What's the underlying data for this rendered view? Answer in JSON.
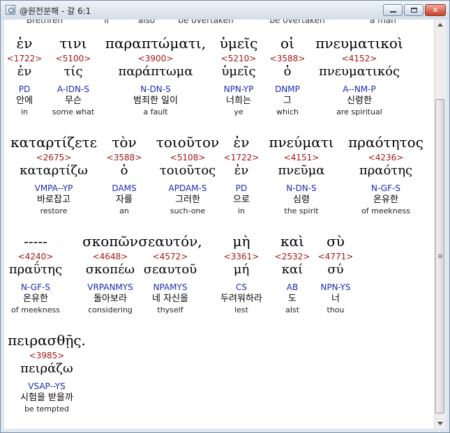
{
  "window": {
    "title": "@원전분해 - 갈 6:1",
    "icon": "app-icon",
    "controls": {
      "minimize": "minimize-icon",
      "maximize": "maximize-icon",
      "close": "close-icon"
    }
  },
  "top_partial": [
    "Brethren",
    "if",
    "also",
    "be overtaken",
    "be overtaken",
    "a man"
  ],
  "rows": [
    {
      "words": [
        {
          "greek": "ἐν",
          "num": "<1722>",
          "lemma": "ἐν",
          "parse": "PD",
          "korean": "안에",
          "english": "in"
        },
        {
          "greek": "τινι",
          "num": "<5100>",
          "lemma": "τίς",
          "parse": "A-IDN-S",
          "korean": "무슨",
          "english": "some what"
        },
        {
          "greek": "παραπτώματι,",
          "num": "<3900>",
          "lemma": "παράπτωμα",
          "parse": "N-DN-S",
          "korean": "범죄한 일이",
          "english": "a fault"
        },
        {
          "greek": "ὑμεῖς",
          "num": "<5210>",
          "lemma": "ὑμεῖς",
          "parse": "NPN-YP",
          "korean": "너희는",
          "english": "ye"
        },
        {
          "greek": "οἱ",
          "num": "<3588>",
          "lemma": "ὁ",
          "parse": "DNMP",
          "korean": "그",
          "english": "which"
        },
        {
          "greek": "πνευματικοὶ",
          "num": "<4152>",
          "lemma": "πνευματικός",
          "parse": "A--NM-P",
          "korean": "신령한",
          "english": "are spiritual"
        }
      ]
    },
    {
      "words": [
        {
          "greek": "καταρτίζετε",
          "num": "<2675>",
          "lemma": "καταρτίζω",
          "parse": "VMPA--YP",
          "korean": "바로잡고",
          "english": "restore"
        },
        {
          "greek": "τὸν",
          "num": "<3588>",
          "lemma": "ὁ",
          "parse": "DAMS",
          "korean": "자를",
          "english": "an"
        },
        {
          "greek": "τοιοῦτον",
          "num": "<5108>",
          "lemma": "τοιοῦτος",
          "parse": "APDAM-S",
          "korean": "그러한",
          "english": "such-one"
        },
        {
          "greek": "ἐν",
          "num": "<1722>",
          "lemma": "ἐν",
          "parse": "PD",
          "korean": "으로",
          "english": "in"
        },
        {
          "greek": "πνεύματι",
          "num": "<4151>",
          "lemma": "πνεῦμα",
          "parse": "N-DN-S",
          "korean": "심령",
          "english": "the spirit"
        },
        {
          "greek": "πραότητος",
          "num": "<4236>",
          "lemma": "πραότης",
          "parse": "N-GF-S",
          "korean": "온유한",
          "english": "of meekness"
        }
      ]
    },
    {
      "words": [
        {
          "greek": "-----",
          "num": "<4240>",
          "lemma": "πραΰτης",
          "parse": "N-GF-S",
          "korean": "온유한",
          "english": "of meekness"
        },
        {
          "greek": "σκοπῶν",
          "num": "<4648>",
          "lemma": "σκοπέω",
          "parse": "VRPANMYS",
          "korean": "돌아보라",
          "english": "considering"
        },
        {
          "greek": "σεαυτόν,",
          "num": "<4572>",
          "lemma": "σεαυτοῦ",
          "parse": "NPAMYS",
          "korean": "네 자신을",
          "english": "thyself"
        },
        {
          "greek": "μὴ",
          "num": "<3361>",
          "lemma": "μή",
          "parse": "CS",
          "korean": "두려워하라",
          "english": "lest"
        },
        {
          "greek": "καὶ",
          "num": "<2532>",
          "lemma": "καί",
          "parse": "AB",
          "korean": "도",
          "english": "alst"
        },
        {
          "greek": "σὺ",
          "num": "<4771>",
          "lemma": "σύ",
          "parse": "NPN-YS",
          "korean": "너",
          "english": "thou"
        }
      ]
    },
    {
      "words": [
        {
          "greek": "πειρασθῇς.",
          "num": "<3985>",
          "lemma": "πειράζω",
          "parse": "VSAP--YS",
          "korean": "시험을 받을까",
          "english": "be tempted"
        }
      ]
    }
  ]
}
